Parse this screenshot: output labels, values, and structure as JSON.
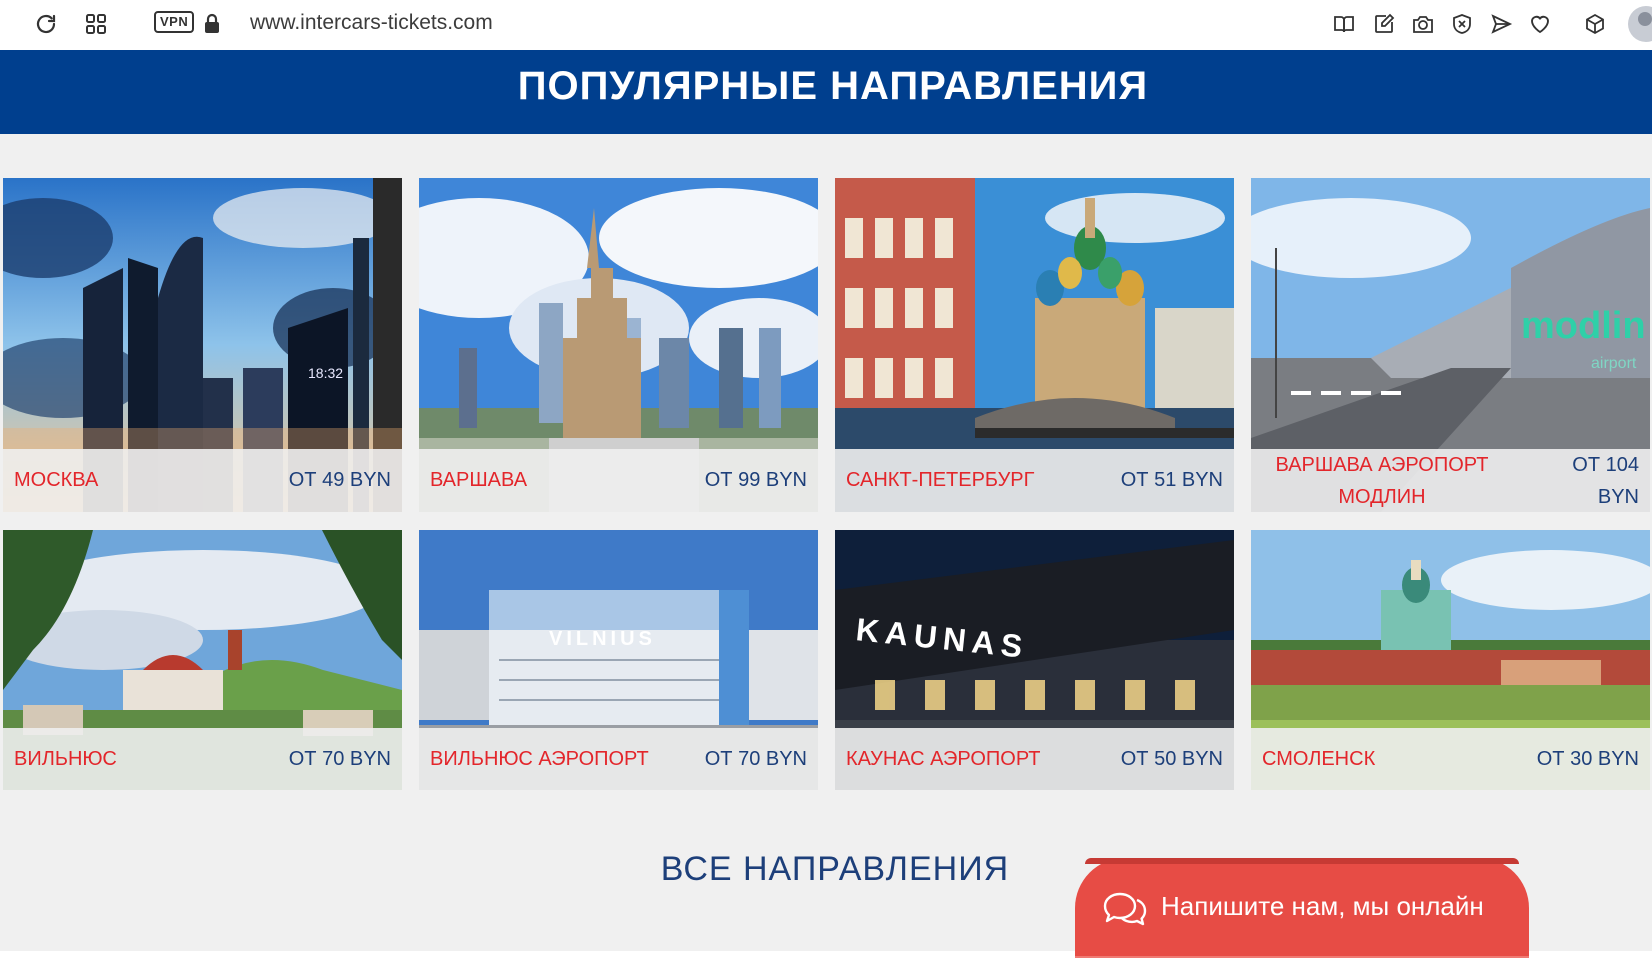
{
  "browser": {
    "url": "www.intercars-tickets.com",
    "vpn_label": "VPN"
  },
  "section": {
    "title": "ПОПУЛЯРНЫЕ НАПРАВЛЕНИЯ"
  },
  "destinations": [
    {
      "city": "МОСКВА",
      "price": "ОТ 49 BYN"
    },
    {
      "city": "ВАРШАВА",
      "price": "ОТ 99 BYN"
    },
    {
      "city": "САНКТ-ПЕТЕРБУРГ",
      "price": "ОТ 51 BYN"
    },
    {
      "city": "ВАРШАВА АЭРОПОРТ МОДЛИН",
      "price": "ОТ 104 BYN"
    },
    {
      "city": "ВИЛЬНЮС",
      "price": "ОТ 70 BYN"
    },
    {
      "city": "ВИЛЬНЮС АЭРОПОРТ",
      "price": "ОТ 70 BYN"
    },
    {
      "city": "КАУНАС АЭРОПОРТ",
      "price": "ОТ 50 BYN"
    },
    {
      "city": "СМОЛЕНСК",
      "price": "ОТ 30 BYN"
    }
  ],
  "photo_texts": {
    "vilnius_airport_sign": "VILNIUS",
    "kaunas_sign": "KAUNAS",
    "modlin_logo": "modlin",
    "modlin_sub": "airport",
    "moscow_clock": "18:32"
  },
  "footer": {
    "all_destinations": "ВСЕ НАПРАВЛЕНИЯ",
    "chat_label": "Напишите нам, мы онлайн"
  },
  "colors": {
    "banner": "#003f8e",
    "city_text": "#e3262b",
    "price_text": "#1d3f7a",
    "chat_button": "#e74c45",
    "page_bg": "#f0f0f0"
  }
}
